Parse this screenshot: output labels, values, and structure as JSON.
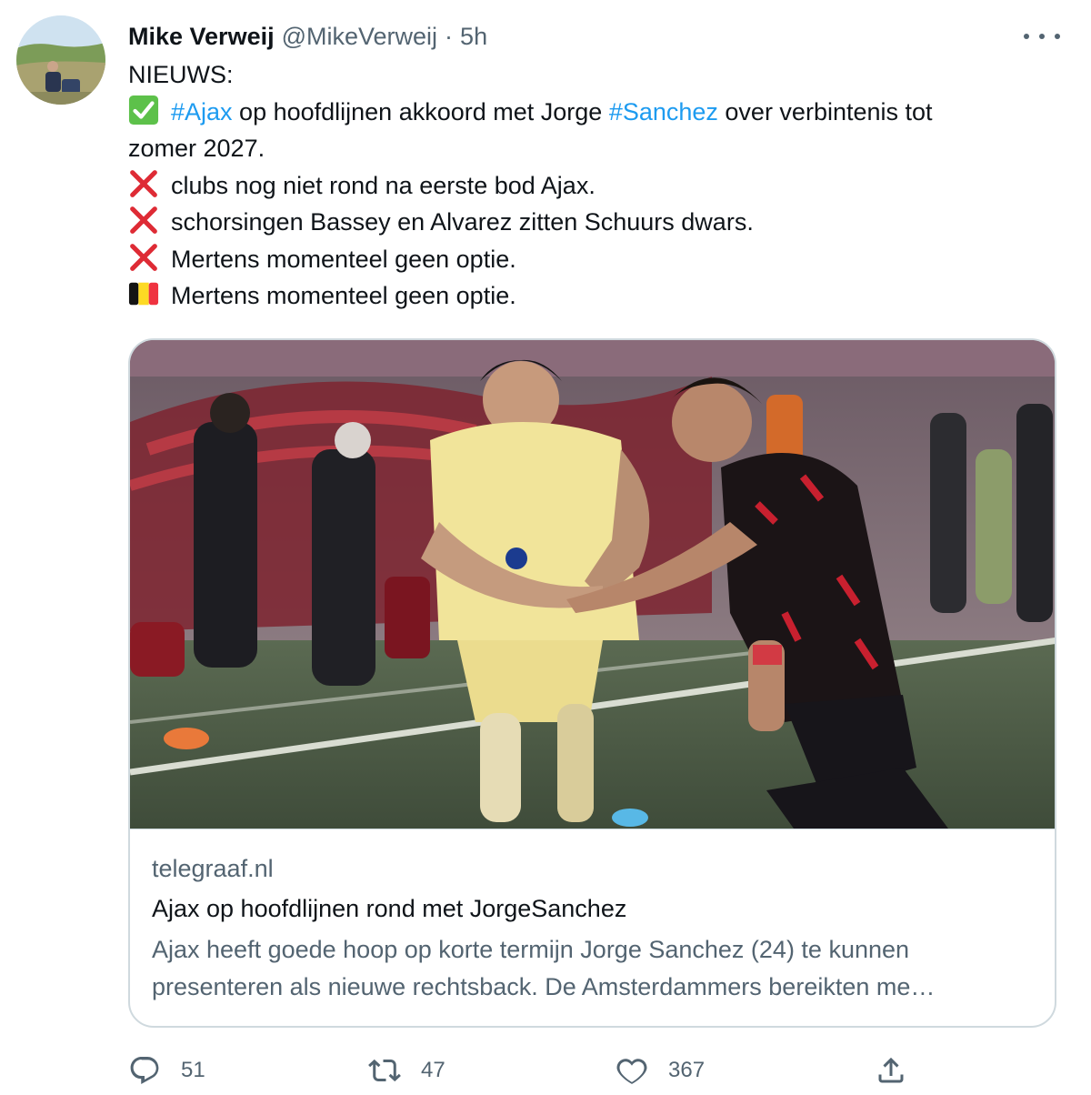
{
  "tweet": {
    "author": {
      "display_name": "Mike Verweij",
      "handle": "@MikeVerweij",
      "separator": "·",
      "time": "5h"
    },
    "more_icon": "more-horizontal-icon",
    "lines": [
      {
        "text": "NIEUWS:"
      },
      {
        "emoji": "check-mark-button",
        "prefix_tag": "#Ajax",
        "mid": " op hoofdlijnen akkoord met Jorge ",
        "tag2": "#Sanchez",
        "suffix": " over verbintenis tot"
      },
      {
        "text": "zomer 2027."
      },
      {
        "emoji": "cross-mark",
        "text": "clubs nog niet rond na eerste bod Ajax."
      },
      {
        "emoji": "cross-mark",
        "text": "schorsingen Bassey en Alvarez zitten Schuurs dwars."
      },
      {
        "emoji": "cross-mark",
        "text": "Mertens momenteel geen optie."
      },
      {
        "emoji": "flag-belgium",
        "text": "Mertens momenteel geen optie."
      }
    ]
  },
  "link_card": {
    "image_desc": "football-match-photo",
    "domain": "telegraaf.nl",
    "title": "Ajax op hoofdlijnen rond met JorgeSanchez",
    "description": "Ajax heeft goede hoop op korte termijn Jorge Sanchez (24) te kunnen presenteren als nieuwe rechtsback. De Amsterdammers bereikten me…"
  },
  "actions": {
    "reply": {
      "icon": "reply-icon",
      "count": "51"
    },
    "retweet": {
      "icon": "retweet-icon",
      "count": "47"
    },
    "like": {
      "icon": "heart-icon",
      "count": "367"
    },
    "share": {
      "icon": "share-icon"
    }
  },
  "colors": {
    "link": "#1d9bf0",
    "secondary_text": "#536471",
    "border": "#cfd9de",
    "check": "#5dc14a",
    "cross": "#de2b35"
  }
}
